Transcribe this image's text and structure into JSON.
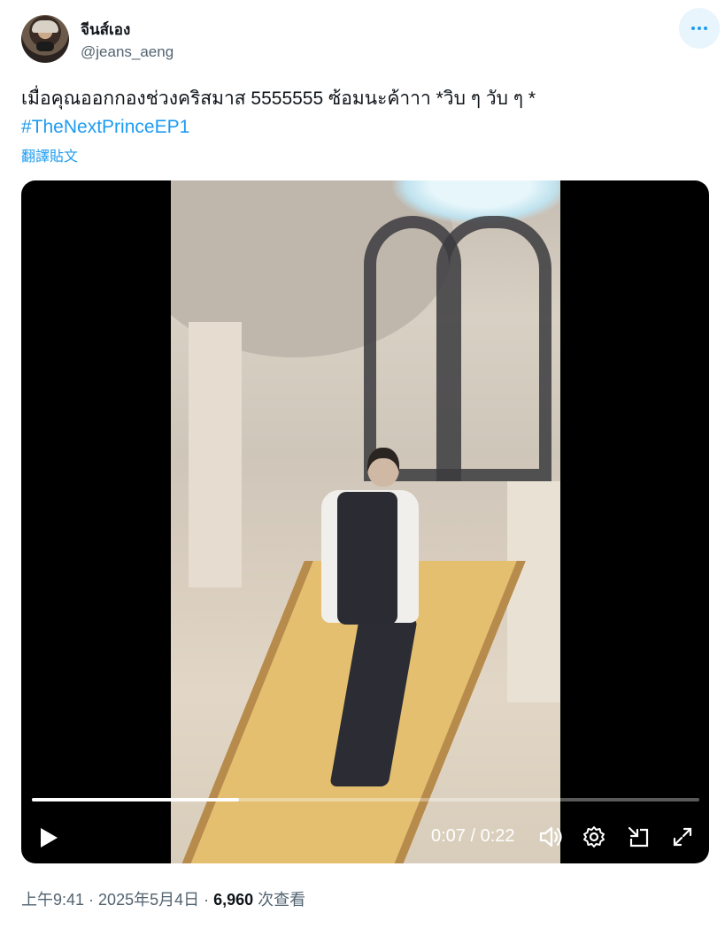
{
  "author": {
    "display_name": "จีนส์เอง",
    "handle": "@jeans_aeng"
  },
  "post": {
    "text": "เมื่อคุณออกกองช่วงคริสมาส 5555555 ซ้อมนะค้าาา *วิบ ๆ วับ ๆ *",
    "hashtag": "#TheNextPrinceEP1",
    "translate_label": "翻譯貼文"
  },
  "video": {
    "current_time": "0:07",
    "separator": " / ",
    "duration": "0:22",
    "progress_fraction": 0.31
  },
  "meta": {
    "time": "上午9:41",
    "dot1": " · ",
    "date": "2025年5月4日",
    "dot2": " · ",
    "views_count": "6,960",
    "views_label": " 次查看"
  },
  "colors": {
    "accent": "#1d9bf0",
    "secondary_text": "#536471",
    "primary_text": "#0f1419"
  },
  "icons": [
    "more-icon",
    "play-icon",
    "volume-icon",
    "settings-icon",
    "pip-icon",
    "fullscreen-icon"
  ]
}
